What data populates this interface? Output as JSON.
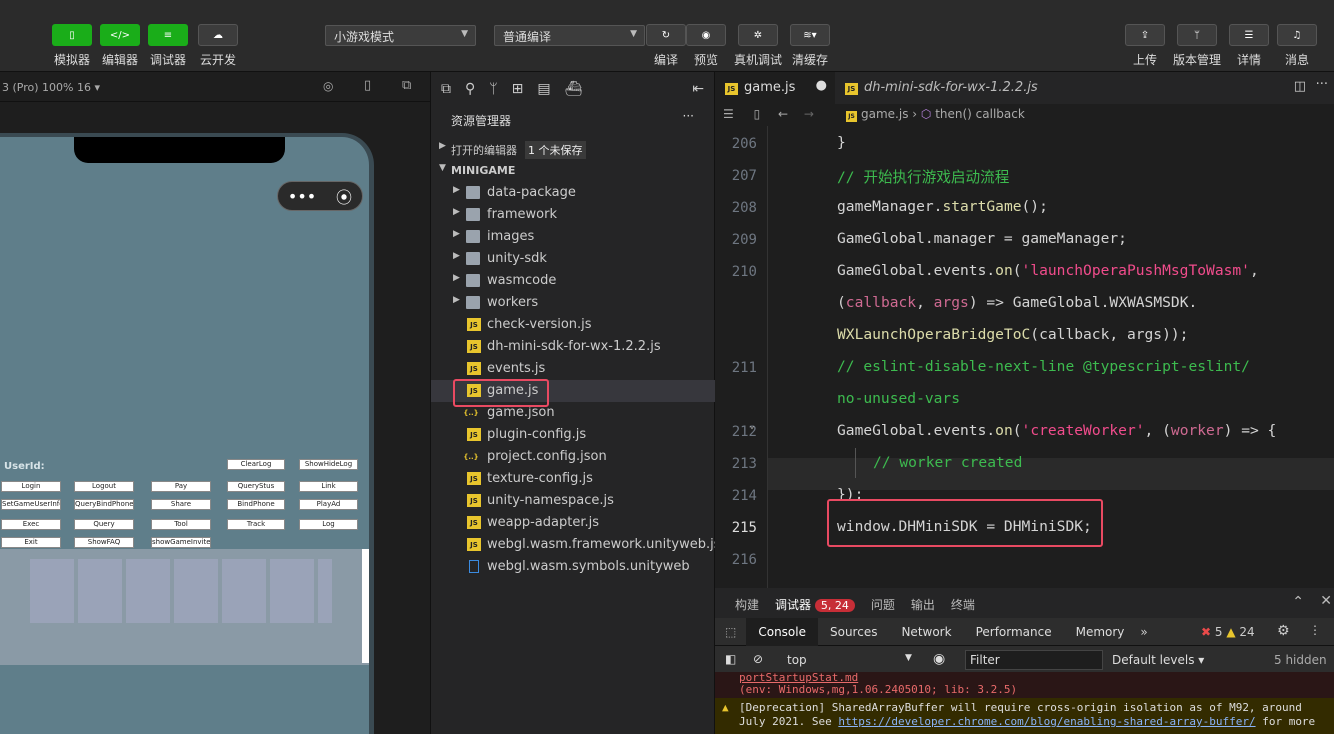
{
  "toolbar": {
    "buttons_left": [
      {
        "label": "模拟器"
      },
      {
        "label": "编辑器"
      },
      {
        "label": "调试器"
      },
      {
        "label": "云开发"
      }
    ],
    "mode_select": "小游戏模式",
    "compile_select": "普通编译",
    "buttons_mid": [
      {
        "label": "编译"
      },
      {
        "label": "预览"
      },
      {
        "label": "真机调试"
      },
      {
        "label": "清缓存"
      }
    ],
    "buttons_right": [
      {
        "label": "上传"
      },
      {
        "label": "版本管理"
      },
      {
        "label": "详情"
      },
      {
        "label": "消息"
      }
    ]
  },
  "simulator": {
    "device_label": "3 (Pro) 100% 16 ▾",
    "userid_label": "UserId:",
    "game_buttons": [
      "ClearLog",
      "ShowHideLog",
      "Login",
      "Logout",
      "Pay",
      "QueryStus",
      "Link",
      "SetGameUserInfo",
      "QueryBindPhone",
      "Share",
      "BindPhone",
      "PlayAd",
      "Exec",
      "Query",
      "Tool",
      "Track",
      "Log",
      "Exit",
      "ShowFAQ",
      "showGameInvite"
    ]
  },
  "explorer": {
    "title": "资源管理器",
    "more": "···",
    "open_editors": "打开的编辑器",
    "unsaved_badge": "1 个未保存",
    "root": "MINIGAME",
    "items": [
      {
        "name": "data-package",
        "kind": "folder"
      },
      {
        "name": "framework",
        "kind": "folder"
      },
      {
        "name": "images",
        "kind": "folder"
      },
      {
        "name": "unity-sdk",
        "kind": "folder"
      },
      {
        "name": "wasmcode",
        "kind": "folder"
      },
      {
        "name": "workers",
        "kind": "folder"
      },
      {
        "name": "check-version.js",
        "kind": "js"
      },
      {
        "name": "dh-mini-sdk-for-wx-1.2.2.js",
        "kind": "js"
      },
      {
        "name": "events.js",
        "kind": "js"
      },
      {
        "name": "game.js",
        "kind": "js"
      },
      {
        "name": "game.json",
        "kind": "json"
      },
      {
        "name": "plugin-config.js",
        "kind": "js"
      },
      {
        "name": "project.config.json",
        "kind": "json"
      },
      {
        "name": "texture-config.js",
        "kind": "js"
      },
      {
        "name": "unity-namespace.js",
        "kind": "js"
      },
      {
        "name": "weapp-adapter.js",
        "kind": "js"
      },
      {
        "name": "webgl.wasm.framework.unityweb.js",
        "kind": "js"
      },
      {
        "name": "webgl.wasm.symbols.unityweb",
        "kind": "doc"
      }
    ]
  },
  "editor": {
    "tabs": [
      {
        "label": "game.js",
        "dot": "●"
      },
      {
        "label": "dh-mini-sdk-for-wx-1.2.2.js"
      }
    ],
    "breadcrumb_file": "game.js",
    "breadcrumb_fn": "then() callback",
    "line_numbers": [
      "206",
      "207",
      "208",
      "209",
      "210",
      "211",
      "212",
      "213",
      "214",
      "215",
      "216"
    ]
  },
  "panel": {
    "tabs": [
      "构建",
      "调试器",
      "问题",
      "输出",
      "终端"
    ],
    "badge": "5, 24",
    "devtools_tabs": [
      "Console",
      "Sources",
      "Network",
      "Performance",
      "Memory"
    ],
    "errors": "5",
    "warnings": "24",
    "context": "top",
    "filter_placeholder": "Filter",
    "levels": "Default levels ▾",
    "hidden": "5 hidden",
    "log1a": "portStartupStat.md",
    "log1b": "(env: Windows,mg,1.06.2405010; lib: 3.2.5)",
    "log2a": "[Deprecation] SharedArrayBuffer will require cross-origin isolation as of M92, around",
    "log2b_pre": "July 2021. See ",
    "log2b_link": "https://developer.chrome.com/blog/enabling-shared-array-buffer/",
    "log2b_post": " for more"
  },
  "colors": {
    "accent_green": "#1aad19",
    "highlight_red": "#e94a62",
    "js_yellow": "#e8c52d"
  }
}
